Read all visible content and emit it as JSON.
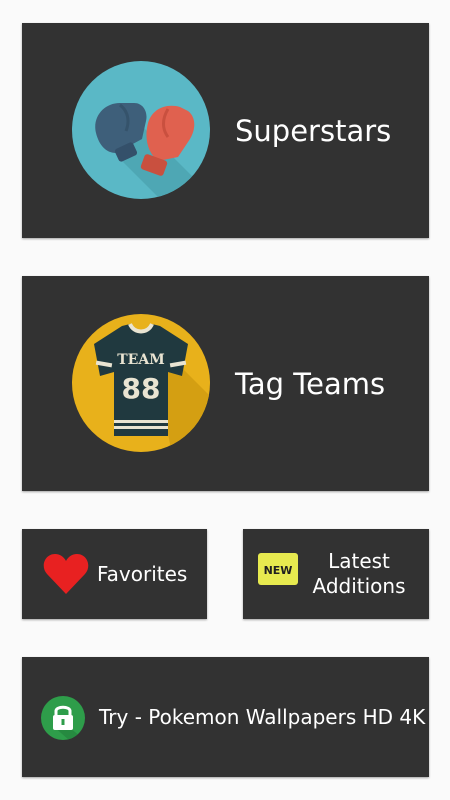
{
  "tiles": {
    "superstars": {
      "label": "Superstars",
      "icon": "boxing-gloves-icon"
    },
    "tag_teams": {
      "label": "Tag Teams",
      "icon": "team-jersey-icon",
      "jersey_text": "TEAM",
      "jersey_number": "88"
    },
    "favorites": {
      "label": "Favorites",
      "icon": "heart-icon"
    },
    "latest": {
      "label_line1": "Latest",
      "label_line2": "Additions",
      "badge": "NEW",
      "icon": "new-badge-icon"
    },
    "promo": {
      "label": "Try - Pokemon Wallpapers HD 4K",
      "icon": "lock-icon"
    }
  },
  "colors": {
    "tile_bg": "#323232",
    "page_bg": "#fafafa",
    "glove_circle": "#5ab8c6",
    "jersey_circle": "#e8b11b",
    "heart": "#e82121",
    "new_badge": "#e7ea4f",
    "lock_circle": "#2e9d4a"
  }
}
